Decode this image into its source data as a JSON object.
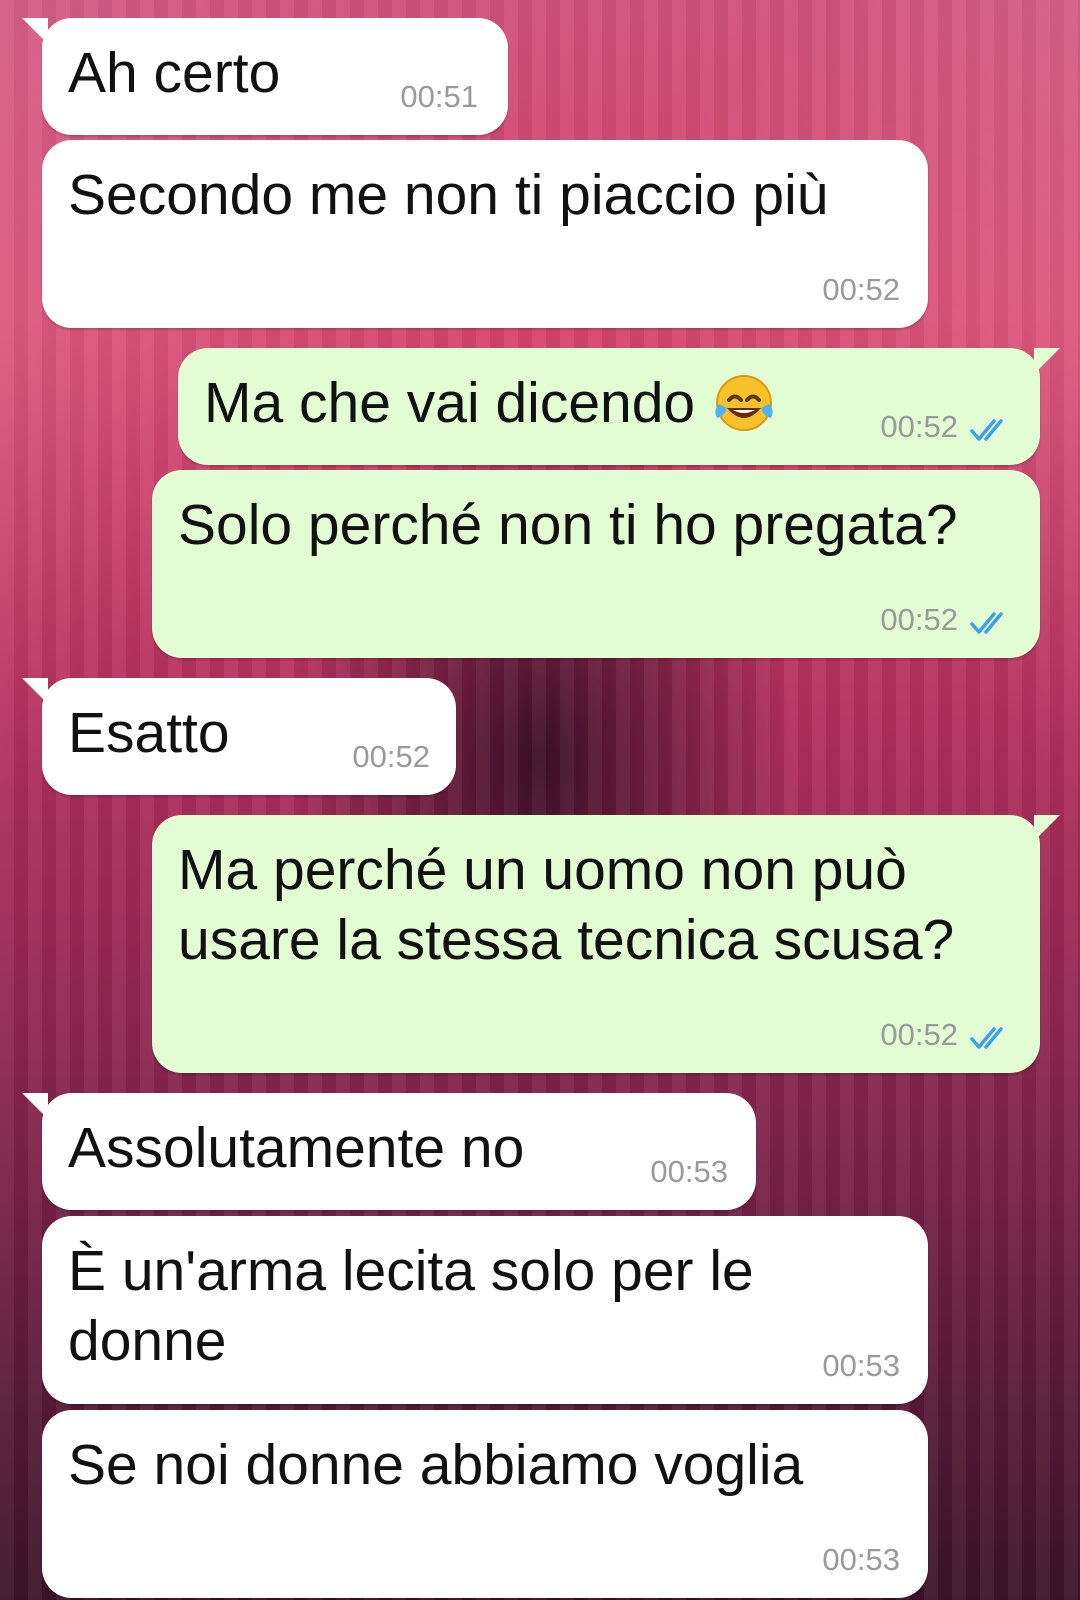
{
  "conversation": {
    "messages": [
      {
        "direction": "in",
        "text": "Ah certo",
        "time": "00:51"
      },
      {
        "direction": "in",
        "text": "Secondo me non ti piaccio più",
        "time": "00:52"
      },
      {
        "direction": "out",
        "text": "Ma che vai dicendo",
        "emoji": "face-with-tears-of-joy",
        "time": "00:52",
        "status": "read"
      },
      {
        "direction": "out",
        "text": "Solo perché non ti ho pregata?",
        "time": "00:52",
        "status": "read"
      },
      {
        "direction": "in",
        "text": "Esatto",
        "time": "00:52"
      },
      {
        "direction": "out",
        "text": "Ma perché un uomo non può\nusare la stessa tecnica scusa?",
        "time": "00:52",
        "status": "read"
      },
      {
        "direction": "in",
        "text": "Assolutamente no",
        "time": "00:53"
      },
      {
        "direction": "in",
        "text": "È un'arma lecita solo per le\ndonne",
        "time": "00:53"
      },
      {
        "direction": "in",
        "text": "Se noi donne abbiamo voglia",
        "time": "00:53"
      }
    ]
  },
  "theme": {
    "incoming_bubble": "#ffffff",
    "outgoing_bubble": "#e2fdd3",
    "read_ticks": "#3da1e8",
    "timestamp": "#9a9a9a"
  }
}
